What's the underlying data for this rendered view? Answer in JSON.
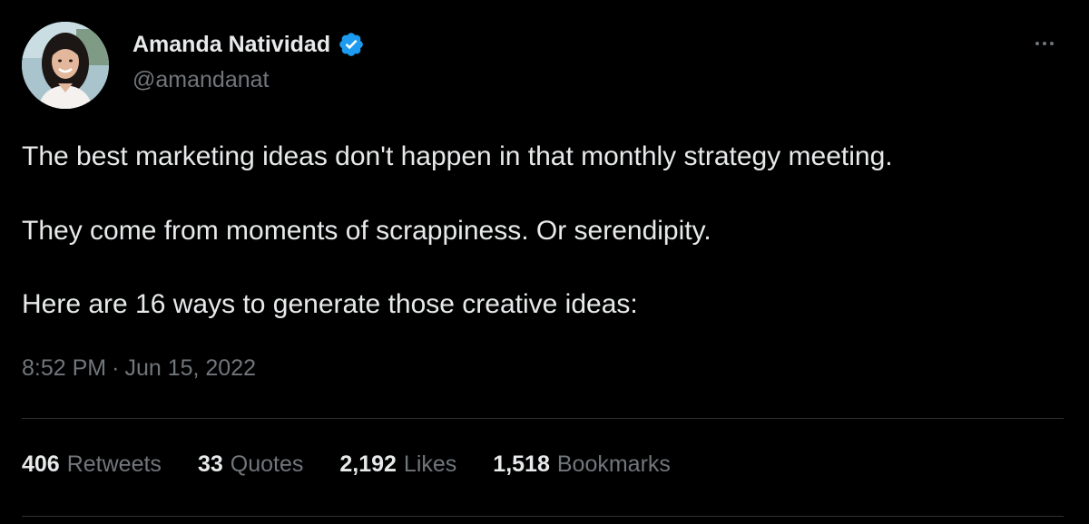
{
  "author": {
    "display_name": "Amanda Natividad",
    "handle": "@amandanat",
    "verified": true,
    "avatar_icon": "profile-photo"
  },
  "tweet": {
    "paragraphs": [
      "The best marketing ideas don't happen in that monthly strategy meeting.",
      "They come from moments of scrappiness. Or serendipity.",
      "Here are 16 ways to generate those creative ideas:"
    ],
    "time": "8:52 PM",
    "separator": "·",
    "date": "Jun 15, 2022"
  },
  "stats": {
    "retweets": {
      "count": "406",
      "label": "Retweets"
    },
    "quotes": {
      "count": "33",
      "label": "Quotes"
    },
    "likes": {
      "count": "2,192",
      "label": "Likes"
    },
    "bookmarks": {
      "count": "1,518",
      "label": "Bookmarks"
    }
  },
  "colors": {
    "background": "#000000",
    "text_primary": "#e7e9ea",
    "text_secondary": "#71767b",
    "verified_blue": "#1d9bf0",
    "divider": "#2f3336"
  },
  "icons": {
    "verified": "verified-badge-icon",
    "more": "more-options-icon"
  }
}
